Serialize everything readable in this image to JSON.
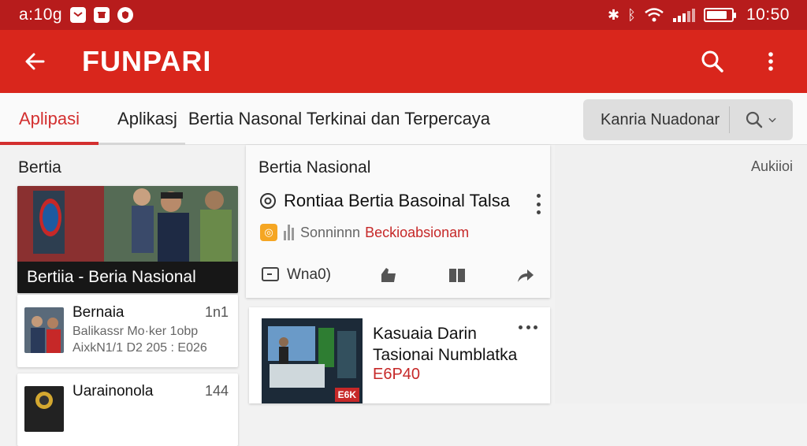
{
  "status_bar": {
    "left_text": "a:10g",
    "time": "10:50",
    "battery_level": 0.85
  },
  "app_bar": {
    "title": "FUNPARI"
  },
  "tabs": {
    "items": [
      {
        "label": "Aplipasi"
      },
      {
        "label": "Aplikasj"
      }
    ],
    "headline": "Bertia Nasonal Terkinai dan Terpercaya",
    "search_label": "Kanria Nuadonar"
  },
  "left": {
    "section_title": "Bertia",
    "hero_caption": "Bertiia - Beria Nasional",
    "list": [
      {
        "title": "Bernaia",
        "count": "1n1",
        "sub1": "Balikassr Mo·ker 1obp",
        "sub2": "AixkN1/1 D2 205 : E026"
      },
      {
        "title": "Uarainonola",
        "count": "144"
      }
    ]
  },
  "middle": {
    "section_title": "Bertia Nasional",
    "headline": "Rontiaa Bertia Basoinal Talsa",
    "source_name": "Sonninnn",
    "source_category": "Beckioabsionam",
    "action_label": "Wna0)",
    "card2": {
      "headline_line1": "Kasuaia Darin",
      "headline_line2": "Tasionai Numblatka",
      "price": "E6P40",
      "badge": "E6K"
    }
  },
  "right": {
    "label": "Aukiioi"
  },
  "colors": {
    "status_bar": "#b71c1c",
    "app_bar": "#d9261c",
    "accent": "#d32f2f"
  }
}
